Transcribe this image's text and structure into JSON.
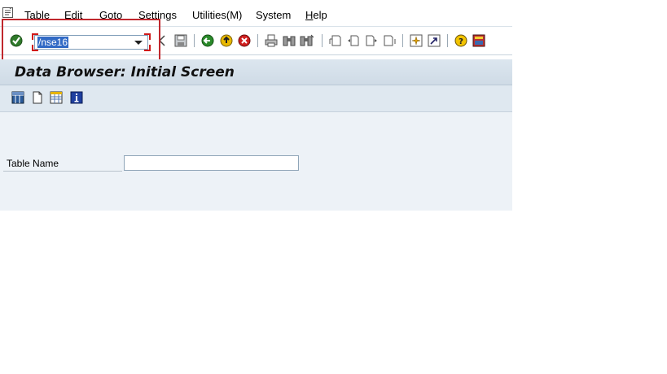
{
  "menu": [
    {
      "label": "Table",
      "mnemonic": "T",
      "rest": "able"
    },
    {
      "label": "Edit",
      "mnemonic": "E",
      "rest": "dit"
    },
    {
      "label": "Goto",
      "mnemonic": "G",
      "rest": "oto"
    },
    {
      "label": "Settings",
      "mnemonic": "S",
      "rest": "ettings"
    },
    {
      "label": "Utilities(M)",
      "mnemonic": "",
      "rest": "Utilities(M)"
    },
    {
      "label": "System",
      "mnemonic": "",
      "rest": "System"
    },
    {
      "label": "Help",
      "mnemonic": "H",
      "rest": "elp"
    }
  ],
  "toolbar": {
    "command_value": "/nse16",
    "icons": [
      "enter-icon",
      "back-arrow-icon",
      "save-icon",
      "back-icon",
      "exit-icon",
      "cancel-icon",
      "print-icon",
      "find-icon",
      "find-next-icon",
      "first-page-icon",
      "previous-page-icon",
      "next-page-icon",
      "last-page-icon",
      "create-session-icon",
      "shortcut-icon",
      "help-icon",
      "customize-layout-icon"
    ]
  },
  "title": "Data Browser: Initial Screen",
  "app_toolbar": {
    "icons": [
      "table-contents-icon",
      "new-entries-icon",
      "table-view-icon",
      "info-icon"
    ]
  },
  "form": {
    "table_name_label": "Table Name",
    "table_name_value": ""
  },
  "colors": {
    "highlight": "#c0272d",
    "title_bg": "#d4dfe9",
    "selection": "#316ac5"
  }
}
